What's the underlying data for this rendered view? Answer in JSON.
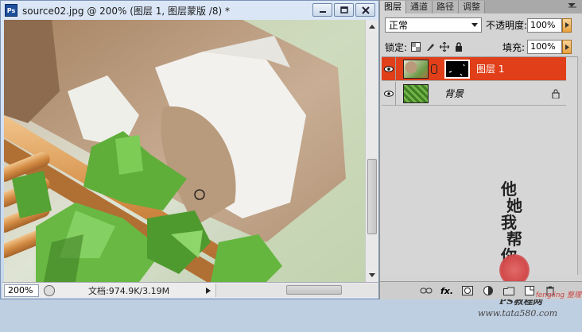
{
  "document": {
    "logo": "Ps",
    "title": "source02.jpg @ 200% (图层 1, 图层蒙版 /8) *",
    "zoom": "200%",
    "doc_info": "文档:974.9K/3.19M"
  },
  "panel": {
    "tabs": [
      "图层",
      "通道",
      "路径",
      "调整"
    ],
    "blend_mode": "正常",
    "opacity_label": "不透明度:",
    "opacity_value": "100%",
    "lock_label": "锁定:",
    "fill_label": "填充:",
    "fill_value": "100%",
    "layers": [
      {
        "name": "图层 1",
        "selected": true
      },
      {
        "name": "背景",
        "selected": false,
        "locked": true
      }
    ],
    "watermark": {
      "lines": [
        "他",
        "她",
        "我",
        "帮",
        "你"
      ],
      "site_name": "PS教程网",
      "site_url": "www.tata580.com"
    },
    "bottom_fx": "fx.",
    "corner_mark": "fengling 整理"
  },
  "icons": [
    "close-icon",
    "maximize-icon",
    "minimize-icon",
    "eye-icon",
    "lock-icon",
    "link-icon",
    "new-layer-icon",
    "trash-icon",
    "mask-icon",
    "adjustment-icon",
    "group-icon"
  ]
}
